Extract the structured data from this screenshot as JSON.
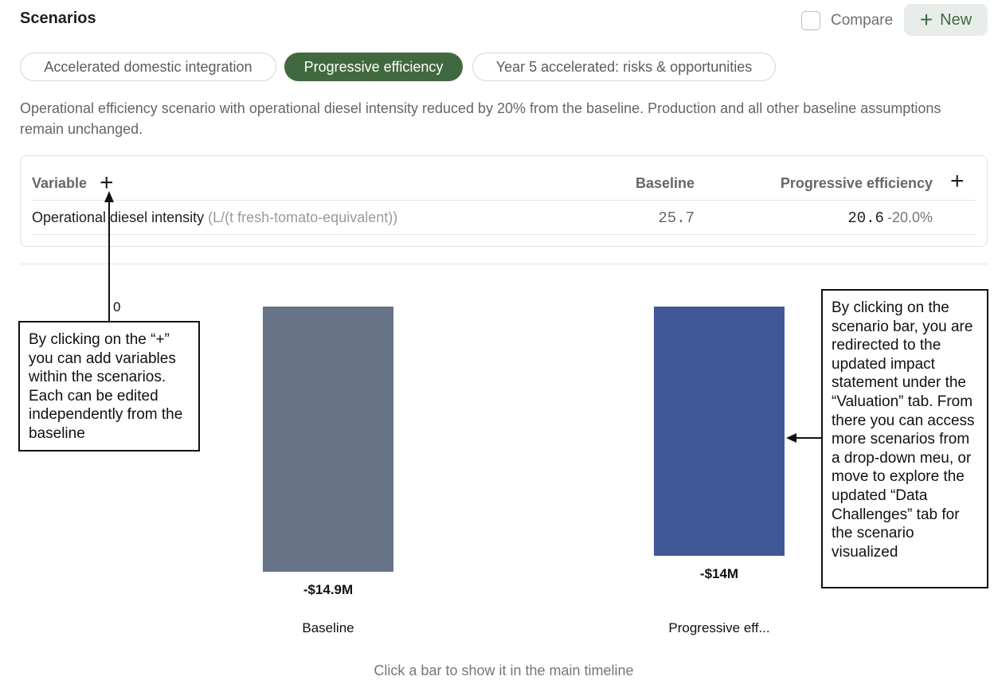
{
  "header": {
    "title": "Scenarios",
    "compare_label": "Compare",
    "new_label": "New"
  },
  "tabs": [
    {
      "label": "Accelerated domestic integration",
      "active": false
    },
    {
      "label": "Progressive efficiency",
      "active": true
    },
    {
      "label": "Year 5 accelerated: risks & opportunities",
      "active": false
    }
  ],
  "description": "Operational efficiency scenario with operational diesel intensity reduced by 20% from the baseline. Production and all other baseline assumptions remain unchanged.",
  "table": {
    "headers": {
      "variable": "Variable",
      "baseline": "Baseline",
      "scenario": "Progressive efficiency"
    },
    "rows": [
      {
        "name": "Operational diesel intensity",
        "unit": "(L/(t fresh-tomato-equivalent))",
        "baseline": "25.7",
        "scenario": "20.6",
        "change": "-20.0%"
      }
    ]
  },
  "chart_data": {
    "type": "bar",
    "categories": [
      "Baseline",
      "Progressive eff..."
    ],
    "values": [
      -14.9,
      -14
    ],
    "value_labels": [
      "-$14.9M",
      "-$14M"
    ],
    "axis_zero_label": "0",
    "colors": [
      "#677386",
      "#405897"
    ]
  },
  "footer_hint": "Click a bar to show it in the main timeline",
  "annotations": {
    "left_callout": "By clicking on the “+” you can add variables within the scenarios. Each can be edited independently from the baseline",
    "right_callout": "By clicking on the scenario bar, you are redirected to the updated impact statement under the “Valuation” tab. From there you can access more scenarios from a drop-down meu, or move to explore the updated “Data Challenges” tab for the scenario visualized"
  },
  "colors": {
    "accent_green": "#41693f",
    "new_button_bg": "#e9ede9"
  }
}
